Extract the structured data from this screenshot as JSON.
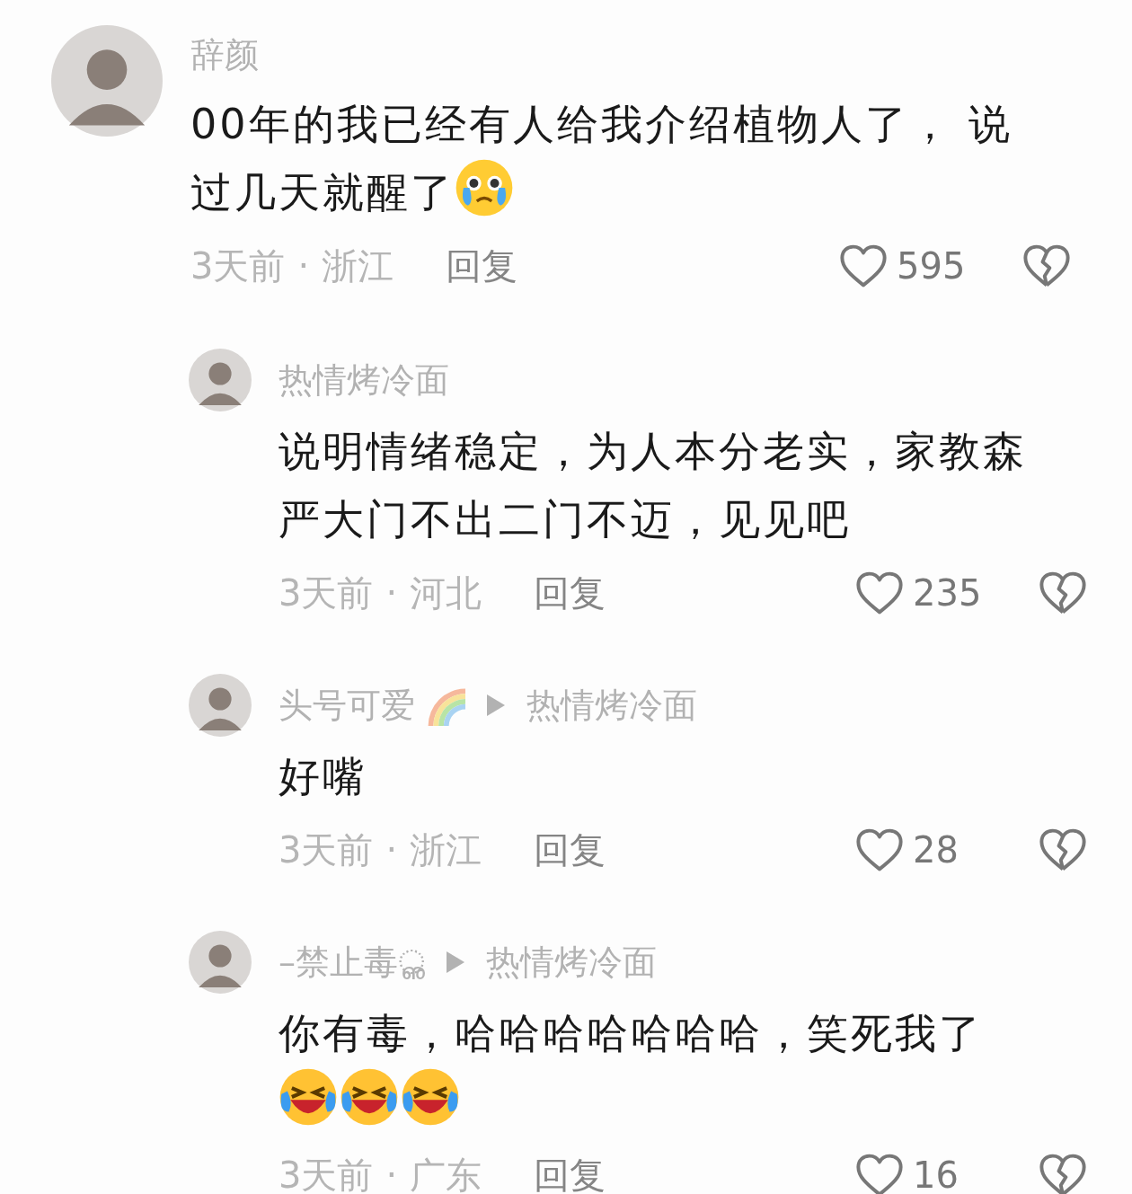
{
  "comments": [
    {
      "author": "辞颜",
      "text": "00年的我已经有人给我介绍植物人了， 说过几天就醒了",
      "emoji": [
        {
          "kind": "pleading-tears"
        }
      ],
      "time": "3天前",
      "separator": "·",
      "region": "浙江",
      "reply": "回复",
      "likes": "595",
      "is_reply": false
    },
    {
      "author": "热情烤冷面",
      "text": "说明情绪稳定，为人本分老实，家教森严大门不出二门不迈，见见吧",
      "time": "3天前",
      "separator": "·",
      "region": "河北",
      "reply": "回复",
      "likes": "235",
      "is_reply": true
    },
    {
      "author": "头号可爱",
      "author_badge": {
        "kind": "rainbow"
      },
      "reply_to": "热情烤冷面",
      "text": "好嘴",
      "time": "3天前",
      "separator": "·",
      "region": "浙江",
      "reply": "回复",
      "likes": "28",
      "is_reply": true
    },
    {
      "author": "–禁止毒ൢ",
      "reply_to": "热情烤冷面",
      "text": "你有毒，哈哈哈哈哈哈哈，笑死我了",
      "emoji": [
        {
          "kind": "laughing-tears"
        },
        {
          "kind": "laughing-tears"
        },
        {
          "kind": "laughing-tears"
        }
      ],
      "time": "3天前",
      "separator": "·",
      "region": "广东",
      "reply": "回复",
      "likes": "16",
      "is_reply": true
    }
  ]
}
